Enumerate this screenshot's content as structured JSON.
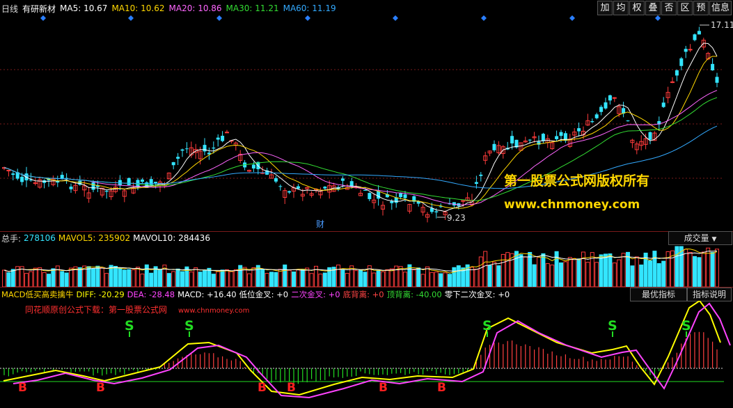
{
  "header": {
    "period": "日线",
    "stock_name": "有研新材",
    "ma": [
      {
        "label": "MA5: 10.67",
        "color": "#ffffff"
      },
      {
        "label": "MA10: 10.62",
        "color": "#ffd700"
      },
      {
        "label": "MA20: 10.86",
        "color": "#ff66ff"
      },
      {
        "label": "MA30: 11.21",
        "color": "#33dd33"
      },
      {
        "label": "MA60: 11.19",
        "color": "#33aaff"
      }
    ],
    "buttons": [
      "加",
      "均",
      "权",
      "叠",
      "否",
      "区",
      "预",
      "信息"
    ]
  },
  "price_panel": {
    "high_label": "17.11",
    "low_label": "9.23",
    "cai_marker": "财",
    "watermark_cn": "第一股票公式网版权所有",
    "watermark_url": "www.chnmoney.com",
    "colors": {
      "up": "#ff3b3b",
      "down": "#33e5ff",
      "diamond": "#2a7fff"
    }
  },
  "volume_panel": {
    "label": "总手:",
    "value": "278106",
    "mavol5": "MAVOL5: 235902",
    "mavol10": "MAVOL10: 284436",
    "tab": "成交量"
  },
  "macd_panel": {
    "name": "MACD低买高卖擒牛",
    "diff": "DIFF: -20.29",
    "dea": "DEA: -28.48",
    "macd": "MACD: +16.40",
    "low_gold": "低位金叉: +0",
    "second_gold": "二次金叉: +0",
    "bottom_div": "底背离: +0",
    "top_div": "顶背离: -40.00",
    "zero_second": "零下二次金叉: +0",
    "tab_best": "最优指标",
    "tab_desc": "指标说明",
    "promo": "同花顺原创公式下载：第一股票公式网",
    "promo_url": "www.chnmoney.com",
    "buy_mark": "B",
    "sell_mark": "S",
    "colors": {
      "diff": "#ffff00",
      "dea": "#ff44ff",
      "buy": "#ff2020",
      "sell": "#22dd22"
    }
  }
}
